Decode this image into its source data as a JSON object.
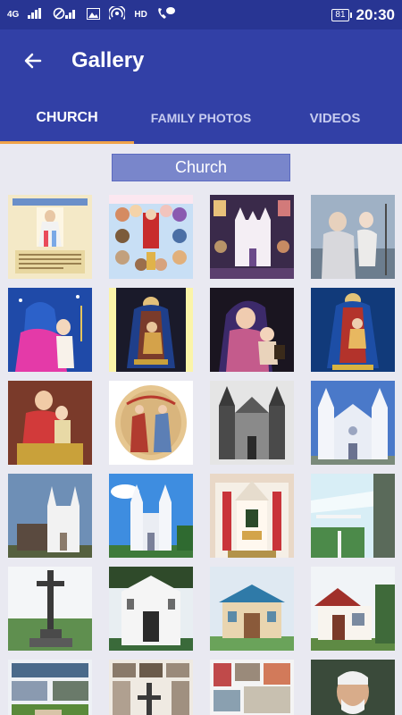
{
  "status_bar": {
    "network": "4G",
    "hd": "HD",
    "battery": "81",
    "time": "20:30"
  },
  "app_bar": {
    "title": "Gallery"
  },
  "tabs": [
    {
      "label": "CHURCH",
      "active": true
    },
    {
      "label": "FAMILY PHOTOS",
      "active": false
    },
    {
      "label": "VIDEOS",
      "active": false
    }
  ],
  "section": {
    "title": "Church"
  },
  "colors": {
    "primary": "#3240a6",
    "status": "#283593",
    "accent": "#f0a34a",
    "header_chip": "#7986cb"
  },
  "thumbnails": [
    "divine-mercy-poster",
    "saints-collage-poster",
    "church-collage-poster",
    "mother-child-painting",
    "madonna-pink-robe",
    "our-lady-carmel-gold",
    "madonna-book",
    "our-lady-blue",
    "mary-statue-red",
    "annunciation-painting",
    "church-facade-bw",
    "church-facade-white",
    "church-side-view",
    "church-front-blue-sky",
    "altar-interior",
    "church-towers-trees",
    "stone-cross",
    "church-entrance-palms",
    "chapel-grotto",
    "small-chapel-white",
    "church-collage-small",
    "cross-collage",
    "church-photos-collage",
    "priest-portrait"
  ]
}
